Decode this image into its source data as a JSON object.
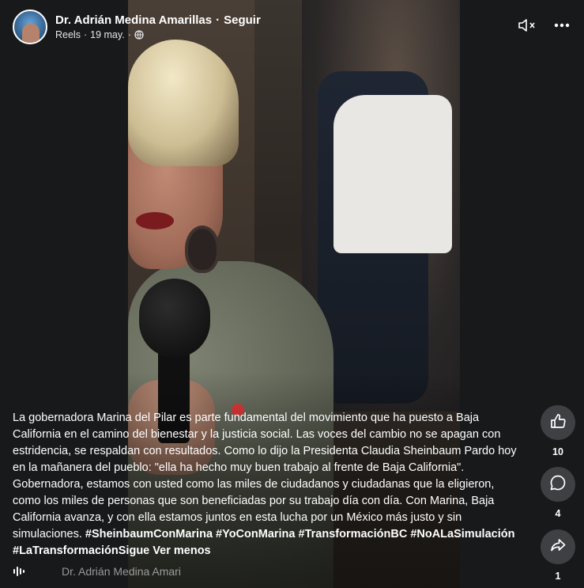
{
  "header": {
    "author_name": "Dr. Adrián Medina Amarillas",
    "separator": "·",
    "follow_label": "Seguir",
    "source": "Reels",
    "date": "19 may.",
    "privacy_icon": "globe-icon"
  },
  "controls": {
    "mute_icon": "speaker-muted-icon",
    "more_icon": "more-dots-icon"
  },
  "caption": {
    "text": "La gobernadora Marina del Pilar es parte fundamental del movimiento que ha puesto a Baja California en el camino del bienestar y la justicia social. Las voces del cambio no se apagan con estridencia, se respaldan con resultados. Como lo dijo la Presidenta Claudia Sheinbaum Pardo hoy en la mañanera del pueblo: \"ella ha hecho muy buen trabajo al frente de Baja California\". Gobernadora, estamos con usted como las miles de ciudadanos y ciudadanas que la eligieron, como los miles de personas que son beneficiadas por su trabajo día con día. Con Marina, Baja California avanza, y con ella estamos juntos en esta lucha por un México más justo y sin simulaciones.",
    "hashtags": "#SheinbaumConMarina #YoConMarina #TransformaciónBC #NoALaSimulación #LaTransformaciónSigue",
    "see_less_label": "Ver menos"
  },
  "actions": {
    "like": {
      "icon": "thumbs-up-icon",
      "count": "10"
    },
    "comment": {
      "icon": "comment-bubble-icon",
      "count": "4"
    },
    "share": {
      "icon": "share-arrow-icon",
      "count": "1"
    }
  },
  "footer": {
    "audio_icon": "audio-bars-icon",
    "audio_author": "Dr. Adrián Medina Amari"
  }
}
